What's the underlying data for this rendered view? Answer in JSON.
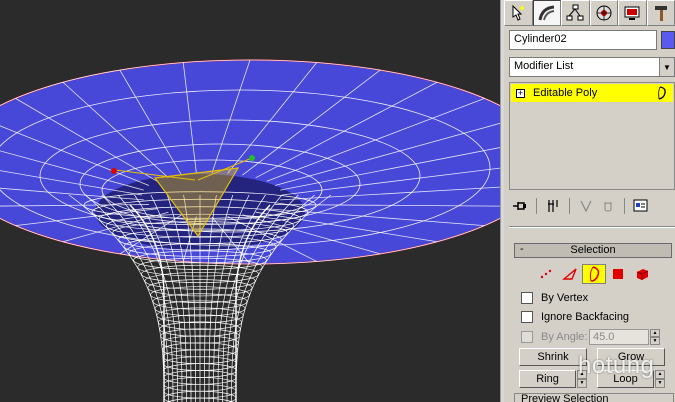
{
  "object": {
    "name": "Cylinder02",
    "color": "#5a5aee"
  },
  "modifier_list": {
    "label": "Modifier List"
  },
  "stack": {
    "items": [
      {
        "label": "Editable Poly"
      }
    ]
  },
  "selection_rollout": {
    "title": "Selection",
    "by_vertex": "By Vertex",
    "ignore_backfacing": "Ignore Backfacing",
    "by_angle": "By Angle:",
    "angle_value": "45.0",
    "shrink": "Shrink",
    "grow": "Grow",
    "ring": "Ring",
    "loop": "Loop"
  },
  "preview_selection": {
    "title": "Preview Selection"
  },
  "watermark": {
    "text": "hotung"
  },
  "colors": {
    "accent": "#ffff00",
    "mesh": "#4848d8",
    "wire": "#ffffff"
  }
}
